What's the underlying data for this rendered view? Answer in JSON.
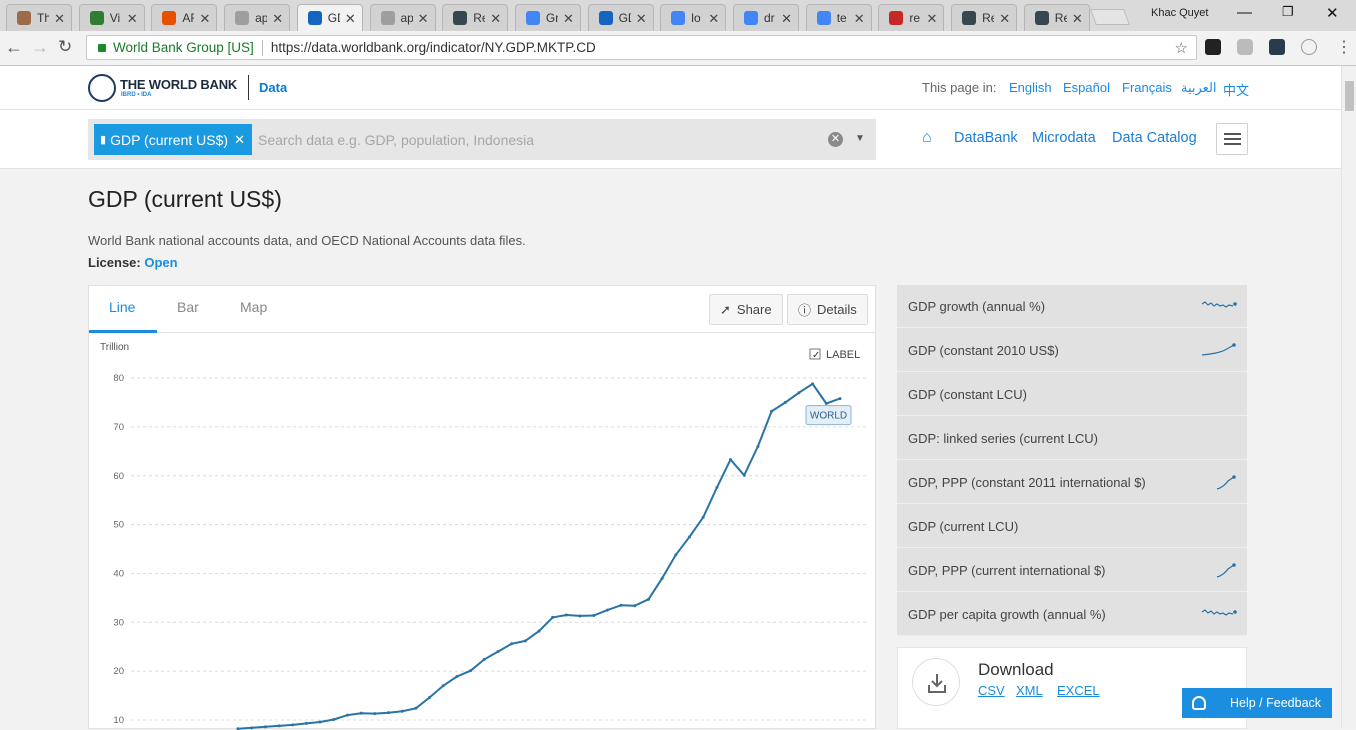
{
  "browser": {
    "tabs": [
      {
        "label": "Th",
        "color": "#9b6b4a"
      },
      {
        "label": "Vi",
        "color": "#2e7d32"
      },
      {
        "label": "AF",
        "color": "#e65100"
      },
      {
        "label": "ap",
        "color": "#9e9e9e"
      },
      {
        "label": "GD",
        "color": "#1565c0"
      },
      {
        "label": "ap",
        "color": "#9e9e9e"
      },
      {
        "label": "Re",
        "color": "#37474f"
      },
      {
        "label": "Gr",
        "color": "#4285f4"
      },
      {
        "label": "GD",
        "color": "#1565c0"
      },
      {
        "label": "lo",
        "color": "#4285f4"
      },
      {
        "label": "dr",
        "color": "#4285f4"
      },
      {
        "label": "te",
        "color": "#4285f4"
      },
      {
        "label": "re",
        "color": "#c62828"
      },
      {
        "label": "Re",
        "color": "#37474f"
      },
      {
        "label": "Re",
        "color": "#37474f"
      }
    ],
    "active_tab_index": 4,
    "profile_name": "Khac Quyet",
    "secure_label": "World Bank Group [US]",
    "url": "https://data.worldbank.org/indicator/NY.GDP.MKTP.CD"
  },
  "header": {
    "brand": "THE WORLD BANK",
    "brand_sub": "IBRD • IDA",
    "section": "Data",
    "lang_label": "This page in:",
    "languages": [
      "English",
      "Español",
      "Français",
      "العربية",
      "中文"
    ]
  },
  "search": {
    "chip_label": "GDP (current US$)",
    "placeholder": "Search data e.g. GDP, population, Indonesia"
  },
  "nav": {
    "links": [
      "DataBank",
      "Microdata",
      "Data Catalog"
    ]
  },
  "page": {
    "title": "GDP (current US$)",
    "description": "World Bank national accounts data, and OECD National Accounts data files.",
    "license_label": "License:",
    "license_value": "Open"
  },
  "chart_tabs": [
    "Line",
    "Bar",
    "Map"
  ],
  "chart_buttons": {
    "share": "Share",
    "details": "Details"
  },
  "chart_options": {
    "label_toggle": "LABEL",
    "label_checked": true
  },
  "chart_data": {
    "type": "line",
    "ylabel": "Trillion",
    "yticks": [
      10,
      20,
      30,
      40,
      50,
      60,
      70,
      80
    ],
    "ylim": [
      8.2,
      82
    ],
    "grid": true,
    "series": [
      {
        "name": "WORLD",
        "color": "#2874a6",
        "values": [
          8.2,
          8.4,
          8.6,
          8.8,
          9.0,
          9.3,
          9.6,
          10.1,
          11.0,
          11.4,
          11.3,
          11.5,
          11.8,
          12.4,
          14.6,
          17.0,
          18.9,
          20.1,
          22.4,
          24.0,
          25.6,
          26.2,
          28.2,
          31.0,
          31.5,
          31.3,
          31.4,
          32.5,
          33.5,
          33.4,
          34.7,
          39.0,
          43.8,
          47.5,
          51.5,
          57.6,
          63.3,
          60.1,
          66.0,
          73.2,
          75.0,
          77.0,
          78.8,
          74.8,
          75.8
        ]
      }
    ]
  },
  "related": [
    {
      "label": "GDP growth (annual %)",
      "spark": "wave"
    },
    {
      "label": "GDP (constant 2010 US$)",
      "spark": "rise"
    },
    {
      "label": "GDP (constant LCU)",
      "spark": ""
    },
    {
      "label": "GDP: linked series (current LCU)",
      "spark": ""
    },
    {
      "label": "GDP, PPP (constant 2011 international $)",
      "spark": "short"
    },
    {
      "label": "GDP (current LCU)",
      "spark": ""
    },
    {
      "label": "GDP, PPP (current international $)",
      "spark": "short"
    },
    {
      "label": "GDP per capita growth (annual %)",
      "spark": "wave"
    }
  ],
  "download": {
    "title": "Download",
    "links": [
      "CSV",
      "XML",
      "EXCEL"
    ]
  },
  "help": {
    "label": "Help / Feedback"
  }
}
